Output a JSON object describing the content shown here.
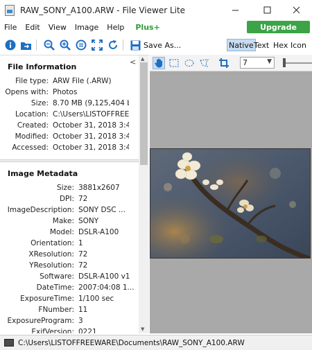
{
  "window": {
    "title": "RAW_SONY_A100.ARW - File Viewer Lite"
  },
  "menu": {
    "items": [
      "File",
      "Edit",
      "View",
      "Image",
      "Help"
    ],
    "plus": "Plus+",
    "upgrade": "Upgrade"
  },
  "toolbar": {
    "save_as": "Save As...",
    "view_tabs": [
      "Native",
      "Text",
      "Hex",
      "Icon"
    ],
    "active_tab": "Native"
  },
  "file_info": {
    "title": "File Information",
    "rows": [
      {
        "k": "File type:",
        "v": "ARW File (.ARW)"
      },
      {
        "k": "Opens with:",
        "v": "Photos"
      },
      {
        "k": "Size:",
        "v": "8.70 MB (9,125,404 b..."
      },
      {
        "k": "Location:",
        "v": "C:\\Users\\LISTOFFREE..."
      },
      {
        "k": "Created:",
        "v": "October 31, 2018 3:4..."
      },
      {
        "k": "Modified:",
        "v": "October 31, 2018 3:4..."
      },
      {
        "k": "Accessed:",
        "v": "October 31, 2018 3:4..."
      }
    ]
  },
  "metadata": {
    "title": "Image Metadata",
    "rows": [
      {
        "k": "Size:",
        "v": "3881x2607"
      },
      {
        "k": "DPI:",
        "v": "72"
      },
      {
        "k": "ImageDescription:",
        "v": "SONY DSC      ..."
      },
      {
        "k": "Make:",
        "v": "SONY"
      },
      {
        "k": "Model:",
        "v": "DSLR-A100"
      },
      {
        "k": "Orientation:",
        "v": "1"
      },
      {
        "k": "XResolution:",
        "v": "72"
      },
      {
        "k": "YResolution:",
        "v": "72"
      },
      {
        "k": "Software:",
        "v": "DSLR-A100 v1"
      },
      {
        "k": "DateTime:",
        "v": "2007:04:08 1..."
      },
      {
        "k": "ExposureTime:",
        "v": "1/100 sec"
      },
      {
        "k": "FNumber:",
        "v": "11"
      },
      {
        "k": "ExposureProgram:",
        "v": "3"
      },
      {
        "k": "ExifVersion:",
        "v": "0221"
      }
    ]
  },
  "viewer": {
    "zoom": "7"
  },
  "status": {
    "path": "C:\\Users\\LISTOFFREEWARE\\Documents\\RAW_SONY_A100.ARW"
  },
  "colors": {
    "upgrade": "#3ca447",
    "plus": "#2e9e35",
    "active_tab": "#c8dcf0",
    "viewer_bg": "#a9a9a9"
  }
}
